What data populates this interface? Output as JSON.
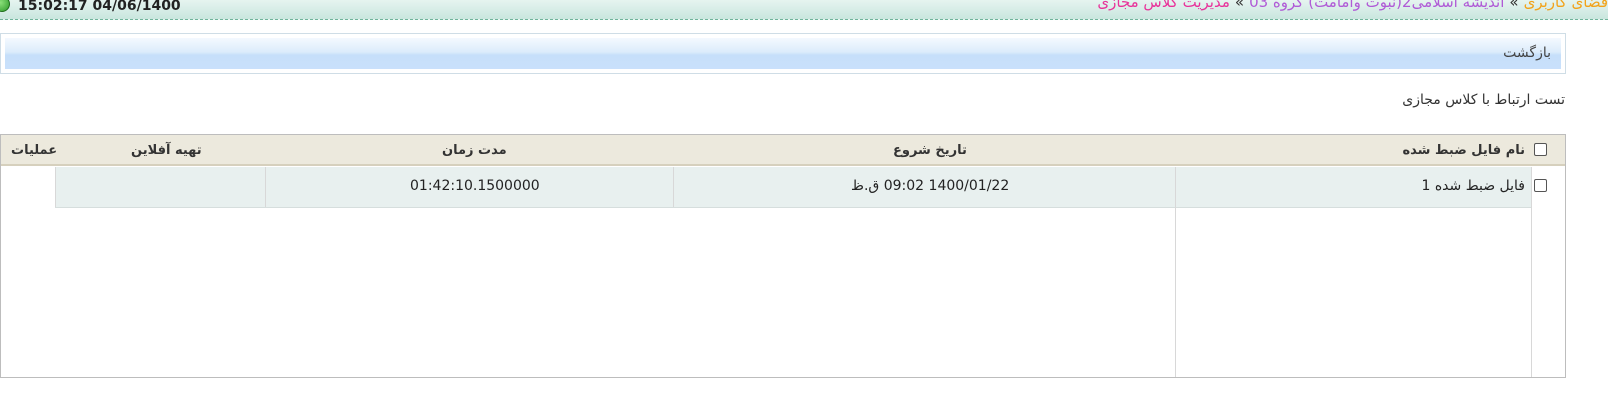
{
  "header": {
    "datetime": "15:02:17 04/06/1400",
    "breadcrumb": {
      "home": "فضای کاربری",
      "separator": "»",
      "course": "اندیشه اسلامی2(نبوت وامامت) گروه 03",
      "current": "مدیریت کلاس مجازی"
    },
    "icons": {
      "clock": "green-circle-icon"
    }
  },
  "back_panel": {
    "label": "بازگشت"
  },
  "test_link": "تست ارتباط با کلاس مجازی",
  "table": {
    "columns": {
      "file_name": "نام فایل ضبط شده",
      "start_date": "تاریخ شروع",
      "duration": "مدت زمان",
      "offline": "تهیه آفلاین",
      "operations": "عملیات"
    },
    "rows": [
      {
        "file_name": "فایل ضبط شده 1",
        "start_date": "1400/01/22 09:02 ق.ظ",
        "duration": "01:42:10.1500000",
        "offline": "",
        "operations": ""
      }
    ]
  },
  "colors": {
    "breadcrumb_home": "#f2a31b",
    "breadcrumb_course": "#b05bd6",
    "breadcrumb_current": "#e8339a",
    "header_bg": "#ece9dd",
    "row_bg": "#e8f0ef"
  }
}
